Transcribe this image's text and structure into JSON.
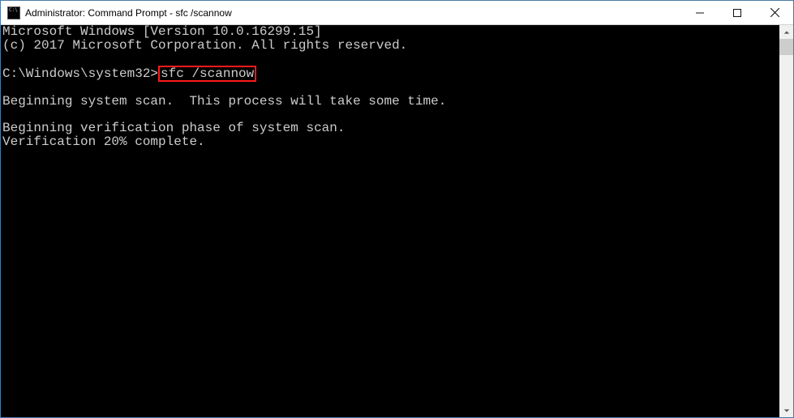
{
  "window": {
    "title": "Administrator: Command Prompt - sfc  /scannow"
  },
  "console": {
    "line1": "Microsoft Windows [Version 10.0.16299.15]",
    "line2": "(c) 2017 Microsoft Corporation. All rights reserved.",
    "blank1": "",
    "prompt": "C:\\Windows\\system32>",
    "command": "sfc /scannow",
    "blank2": "",
    "scan1": "Beginning system scan.  This process will take some time.",
    "blank3": "",
    "scan2": "Beginning verification phase of system scan.",
    "scan3": "Verification 20% complete."
  }
}
